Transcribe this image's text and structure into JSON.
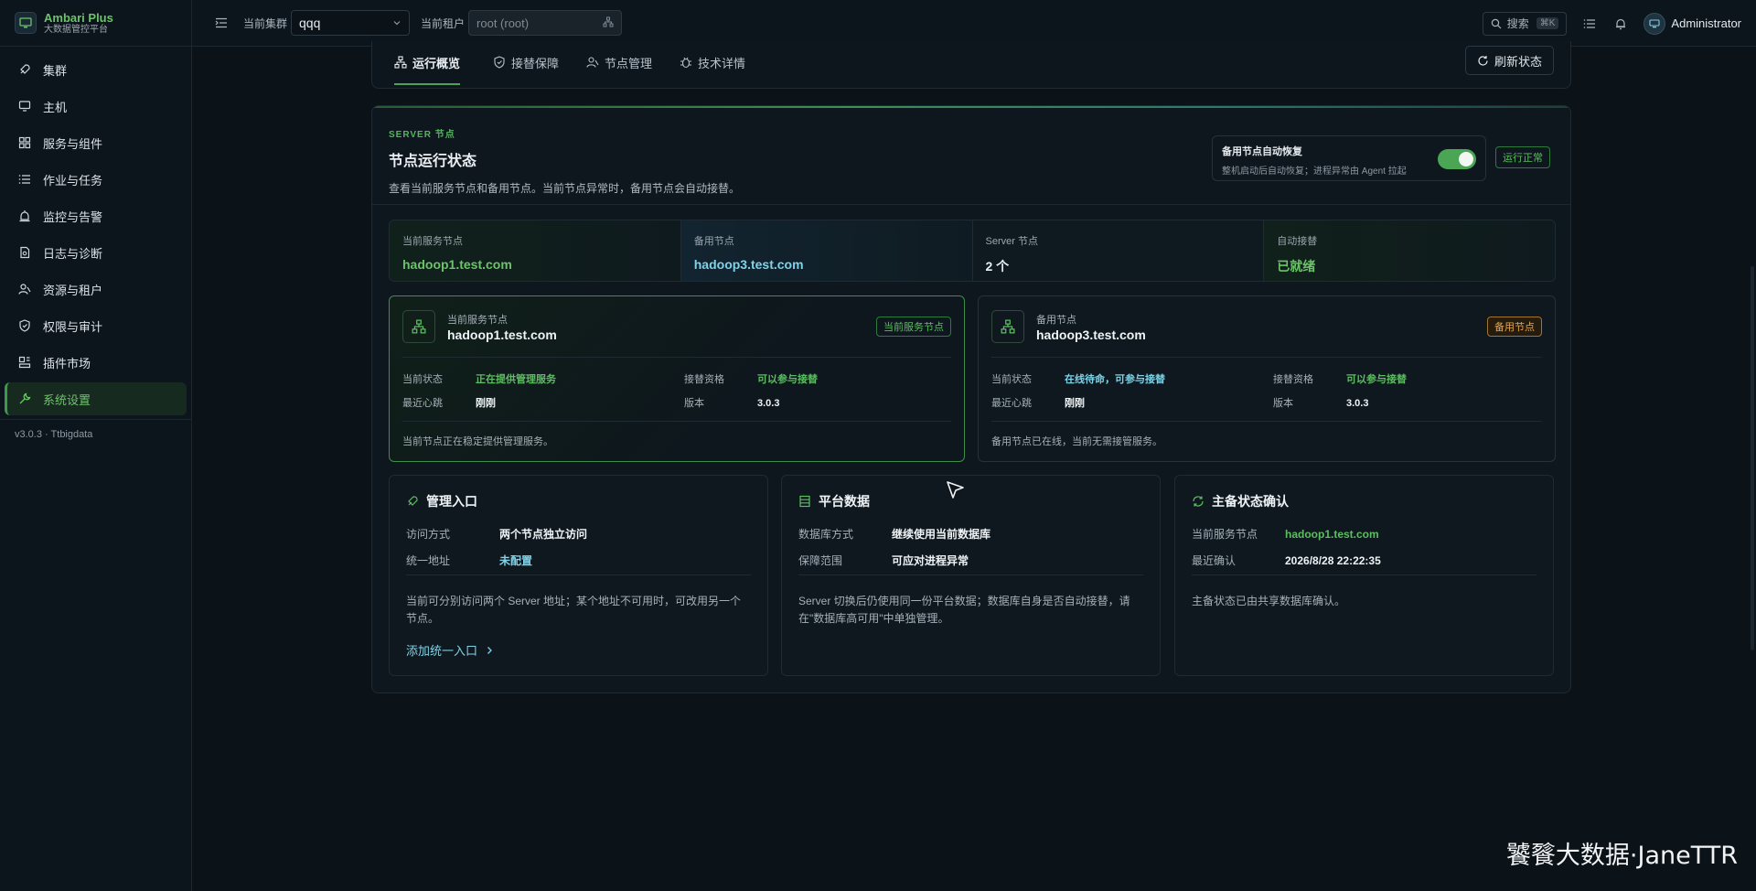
{
  "brand": {
    "name": "Ambari Plus",
    "subtitle": "大数据管控平台"
  },
  "sidebar": {
    "items": [
      {
        "label": "集群",
        "icon": "rocket-icon"
      },
      {
        "label": "主机",
        "icon": "monitor-icon"
      },
      {
        "label": "服务与组件",
        "icon": "grid-icon"
      },
      {
        "label": "作业与任务",
        "icon": "list-icon"
      },
      {
        "label": "监控与告警",
        "icon": "alarm-icon"
      },
      {
        "label": "日志与诊断",
        "icon": "file-search-icon"
      },
      {
        "label": "资源与租户",
        "icon": "users-icon"
      },
      {
        "label": "权限与审计",
        "icon": "shield-icon"
      },
      {
        "label": "插件市场",
        "icon": "plugin-icon"
      },
      {
        "label": "系统设置",
        "icon": "wrench-icon",
        "active": true
      }
    ],
    "version": "v3.0.3 · Ttbigdata"
  },
  "topbar": {
    "cluster_label": "当前集群",
    "cluster_value": "qqq",
    "tenant_label": "当前租户",
    "tenant_value": "root (root)",
    "search_label": "搜索",
    "search_shortcut": "⌘K",
    "username": "Administrator"
  },
  "tabs": [
    {
      "label": "运行概览",
      "active": true
    },
    {
      "label": "接替保障"
    },
    {
      "label": "节点管理"
    },
    {
      "label": "技术详情"
    }
  ],
  "refresh_label": "刷新状态",
  "panel": {
    "eyebrow": "SERVER 节点",
    "title": "节点运行状态",
    "description": "查看当前服务节点和备用节点。当前节点异常时，备用节点会自动接替。",
    "auto_recover": {
      "title": "备用节点自动恢复",
      "desc": "整机启动后自动恢复；进程异常由 Agent 拉起",
      "enabled": true
    },
    "status": "运行正常"
  },
  "stats": [
    {
      "label": "当前服务节点",
      "value": "hadoop1.test.com"
    },
    {
      "label": "备用节点",
      "value": "hadoop3.test.com"
    },
    {
      "label": "Server 节点",
      "value": "2 个"
    },
    {
      "label": "自动接替",
      "value": "已就绪"
    }
  ],
  "primary_node": {
    "role": "当前服务节点",
    "host": "hadoop1.test.com",
    "badge": "当前服务节点",
    "state_label": "当前状态",
    "state_value": "正在提供管理服务",
    "eligibility_label": "接替资格",
    "eligibility_value": "可以参与接替",
    "heartbeat_label": "最近心跳",
    "heartbeat_value": "刚刚",
    "version_label": "版本",
    "version_value": "3.0.3",
    "note": "当前节点正在稳定提供管理服务。"
  },
  "backup_node": {
    "role": "备用节点",
    "host": "hadoop3.test.com",
    "badge": "备用节点",
    "state_label": "当前状态",
    "state_value": "在线待命，可参与接替",
    "eligibility_label": "接替资格",
    "eligibility_value": "可以参与接替",
    "heartbeat_label": "最近心跳",
    "heartbeat_value": "刚刚",
    "version_label": "版本",
    "version_value": "3.0.3",
    "note": "备用节点已在线，当前无需接管服务。"
  },
  "entry_card": {
    "title": "管理入口",
    "access_label": "访问方式",
    "access_value": "两个节点独立访问",
    "address_label": "统一地址",
    "address_value": "未配置",
    "note": "当前可分别访问两个 Server 地址；某个地址不可用时，可改用另一个节点。",
    "link": "添加统一入口"
  },
  "data_card": {
    "title": "平台数据",
    "db_label": "数据库方式",
    "db_value": "继续使用当前数据库",
    "scope_label": "保障范围",
    "scope_value": "可应对进程异常",
    "note": "Server 切换后仍使用同一份平台数据；数据库自身是否自动接替，请在\"数据库高可用\"中单独管理。"
  },
  "confirm_card": {
    "title": "主备状态确认",
    "node_label": "当前服务节点",
    "node_value": "hadoop1.test.com",
    "time_label": "最近确认",
    "time_value": "2026/8/28 22:22:35",
    "note": "主备状态已由共享数据库确认。"
  },
  "watermark": "饕餮大数据·JaneTTR",
  "colors": {
    "accent_green": "#5dbd62",
    "accent_cyan": "#7fd3e8",
    "amber": "#e3a54d",
    "background": "#0b1218"
  }
}
